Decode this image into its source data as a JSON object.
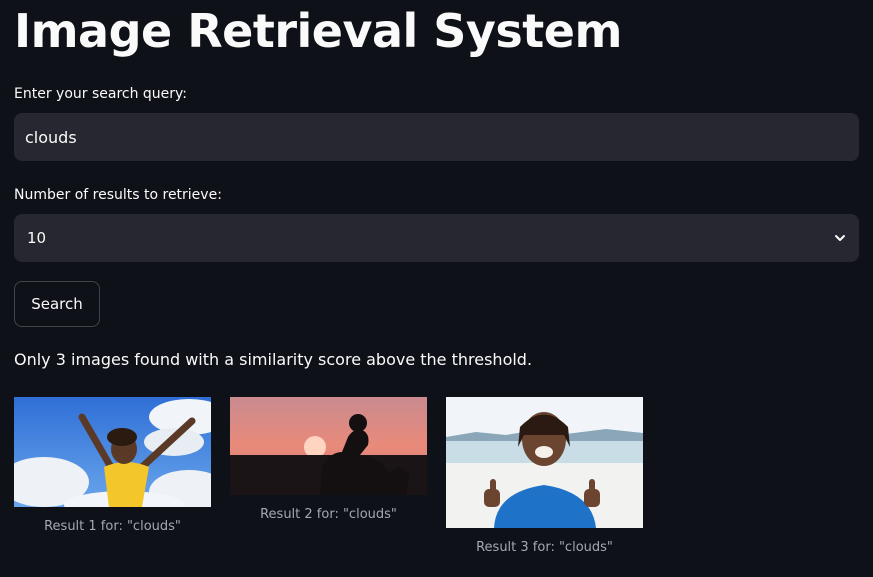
{
  "app": {
    "title": "Image Retrieval System"
  },
  "query": {
    "label": "Enter your search query:",
    "value": "clouds"
  },
  "num_results": {
    "label": "Number of results to retrieve:",
    "selected": "10"
  },
  "search_button": {
    "label": "Search"
  },
  "status_message": "Only 3 images found with a similarity score above the threshold.",
  "results": [
    {
      "caption": "Result 1 for: \"clouds\"",
      "image": "woman-arms-raised-blue-sky-clouds"
    },
    {
      "caption": "Result 2 for: \"clouds\"",
      "image": "silhouette-sitting-sunset"
    },
    {
      "caption": "Result 3 for: \"clouds\"",
      "image": "man-thumbs-up-beach"
    }
  ],
  "icons": {
    "select_chevron": "chevron-down-icon"
  },
  "colors": {
    "background": "#0e1117",
    "input_background": "#262730",
    "text": "#fafafa",
    "caption": "#a3a8b4"
  }
}
